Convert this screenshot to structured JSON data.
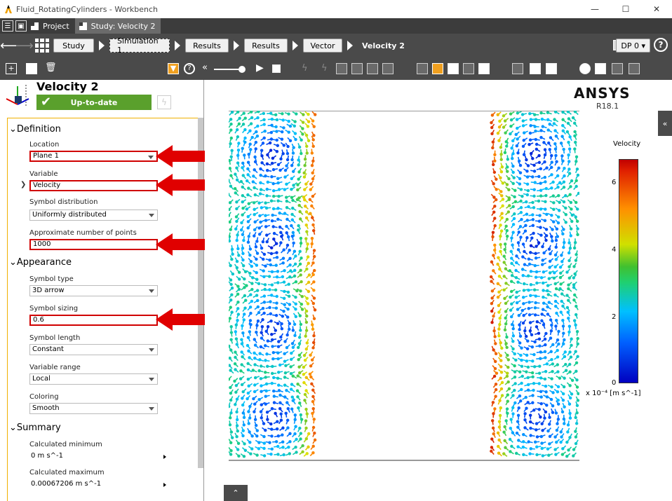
{
  "window": {
    "title": "Fluid_RotatingCylinders - Workbench",
    "minimize": "—",
    "maximize": "☐",
    "close": "✕"
  },
  "tabs": [
    {
      "label": "Project"
    },
    {
      "label": "Study: Velocity 2"
    }
  ],
  "breadcrumb": {
    "items": [
      "Study",
      "Simulation 1",
      "Results",
      "Results",
      "Vector",
      "Velocity 2"
    ],
    "dp_label": "DP 0 ▾",
    "help": "?"
  },
  "panel": {
    "title": "Velocity 2",
    "status": "Up-to-date",
    "sections": {
      "definition": "Definition",
      "appearance": "Appearance",
      "summary": "Summary"
    },
    "fields": {
      "location": {
        "label": "Location",
        "value": "Plane 1"
      },
      "variable": {
        "label": "Variable",
        "value": "Velocity"
      },
      "symbol_distribution": {
        "label": "Symbol distribution",
        "value": "Uniformly distributed"
      },
      "approx_points": {
        "label": "Approximate number of points",
        "value": "1000"
      },
      "symbol_type": {
        "label": "Symbol type",
        "value": "3D arrow"
      },
      "symbol_sizing": {
        "label": "Symbol sizing",
        "value": "0.6"
      },
      "symbol_length": {
        "label": "Symbol length",
        "value": "Constant"
      },
      "variable_range": {
        "label": "Variable range",
        "value": "Local"
      },
      "coloring": {
        "label": "Coloring",
        "value": "Smooth"
      },
      "calc_min": {
        "label": "Calculated minimum",
        "value": "0 m s^-1"
      },
      "calc_max": {
        "label": "Calculated maximum",
        "value": "0.00067206 m s^-1"
      }
    }
  },
  "viewport": {
    "brand": "ANSYS",
    "release": "R18.1",
    "legend": {
      "title": "Velocity",
      "ticks": [
        "6",
        "4",
        "2",
        "0"
      ],
      "units": "x 10⁻⁴ [m s^-1]"
    }
  },
  "colors": {
    "accent_red": "#d00000",
    "status_green": "#5aa02c",
    "toolbar_dark": "#4a4a4a",
    "highlight_orange": "#f0a020"
  }
}
